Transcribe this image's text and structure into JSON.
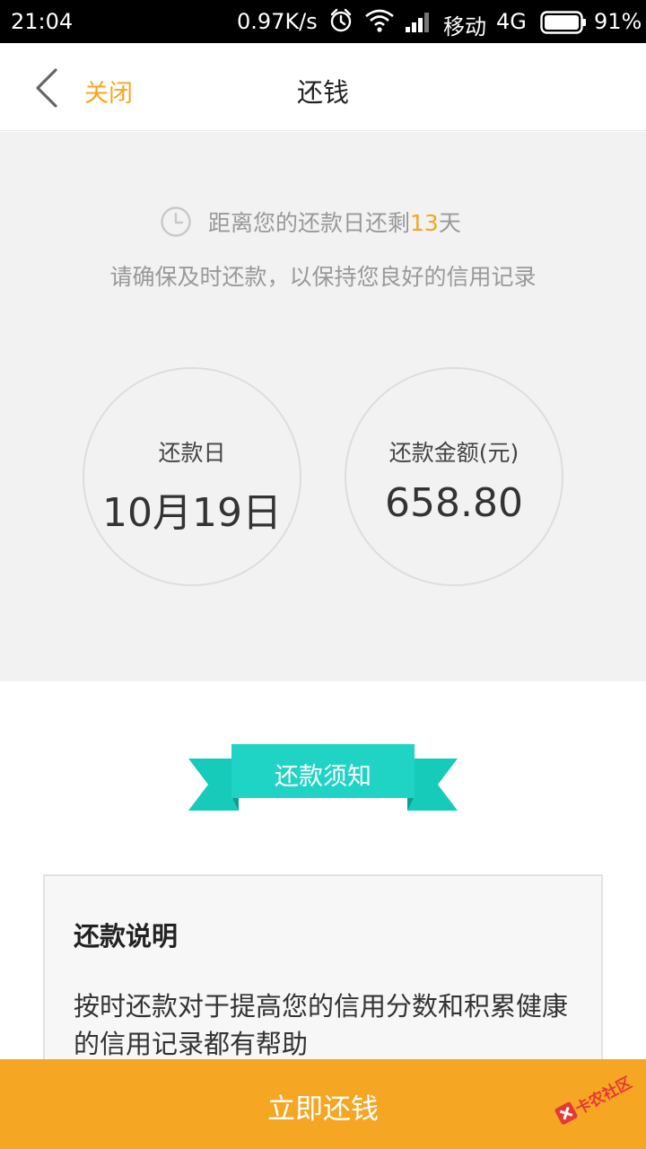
{
  "status_bar": {
    "time": "21:04",
    "speed": "0.97K/s",
    "carrier": "移动",
    "network": "4G",
    "battery_percent": "91%",
    "icons": [
      "alarm-icon",
      "wifi-icon",
      "signal-icon",
      "battery-icon"
    ]
  },
  "header": {
    "back_icon": "chevron-left-icon",
    "close_label": "关闭",
    "title": "还钱"
  },
  "summary": {
    "remain_prefix": "距离您的还款日还剩",
    "remain_days": "13",
    "remain_suffix": "天",
    "tip": "请确保及时还款，以保持您良好的信用记录",
    "due_date_label": "还款日",
    "due_date_value": "10月19日",
    "amount_label": "还款金额(元)",
    "amount_value": "658.80"
  },
  "notice": {
    "ribbon_label": "还款须知",
    "title": "还款说明",
    "body": "按时还款对于提高您的信用分数和积累健康的信用记录都有帮助"
  },
  "action": {
    "pay_label": "立即还钱"
  },
  "watermark": {
    "text": "卡农社区"
  },
  "colors": {
    "accent": "#f5a623",
    "teal": "#17cbbb",
    "teal_dark": "#0e9e90"
  }
}
